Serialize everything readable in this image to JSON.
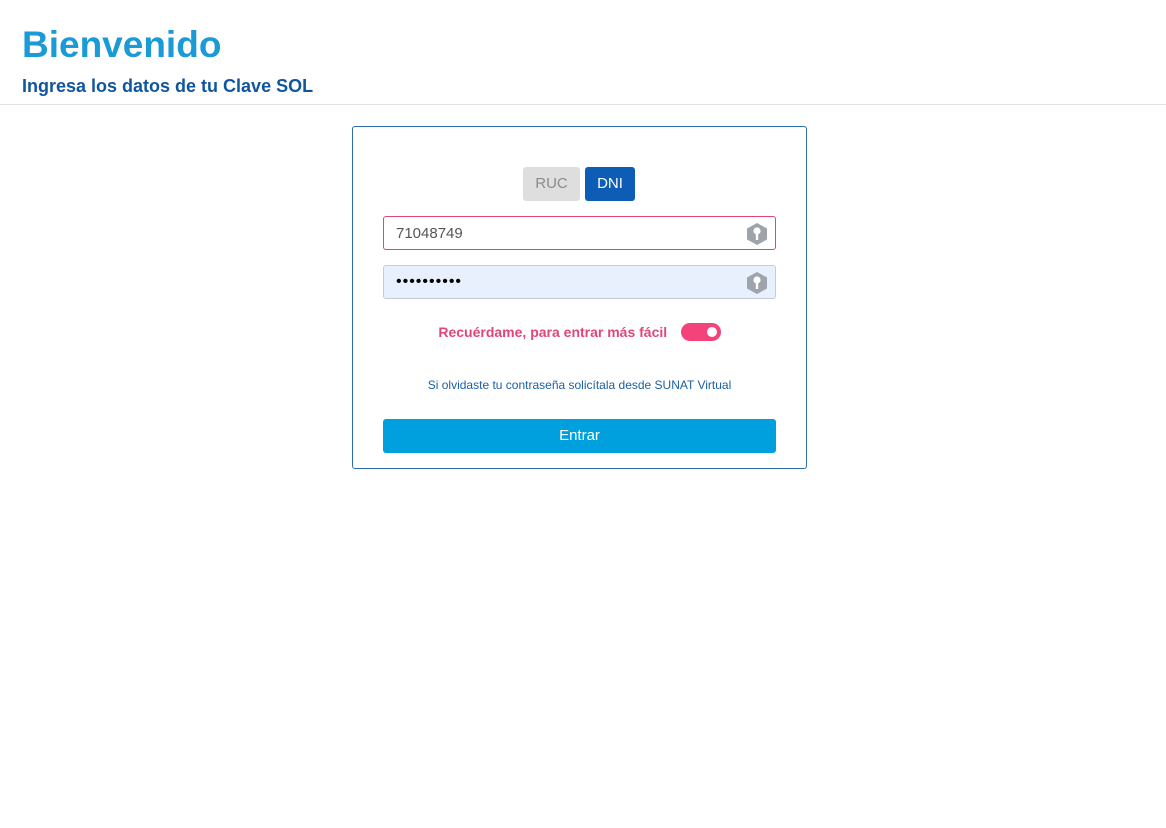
{
  "header": {
    "title": "Bienvenido",
    "subtitle": "Ingresa los datos de tu Clave SOL"
  },
  "login": {
    "tabs": [
      {
        "label": "RUC",
        "active": false
      },
      {
        "label": "DNI",
        "active": true
      }
    ],
    "user_field": {
      "value": "71048749",
      "icon": "key-icon"
    },
    "password_field": {
      "value": "••••••••••",
      "icon": "key-icon"
    },
    "remember": {
      "label": "Recuérdame, para entrar más fácil",
      "enabled": true
    },
    "forgot_link": "Si olvidaste tu contraseña solicítala desde SUNAT Virtual",
    "submit_label": "Entrar"
  },
  "colors": {
    "brand_blue": "#1a9ad7",
    "dark_blue": "#10569e",
    "active_tab": "#0d5cb6",
    "accent_pink": "#e0457b",
    "submit_button": "#009fde"
  }
}
